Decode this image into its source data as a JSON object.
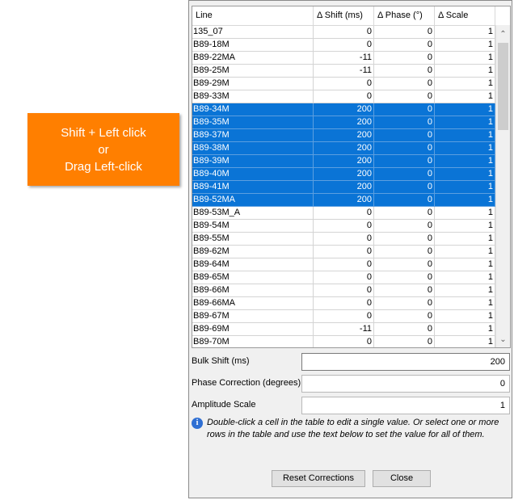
{
  "callout": {
    "line1": "Shift + Left click",
    "line2": "or",
    "line3": "Drag Left-click",
    "color": "#ff7f00"
  },
  "table": {
    "headers": [
      "Line",
      "Δ Shift (ms)",
      "Δ Phase (°)",
      "Δ Scale"
    ],
    "selection_color": "#0a74d6",
    "rows": [
      {
        "line": "135_07",
        "shift": "0",
        "phase": "0",
        "scale": "1",
        "selected": false
      },
      {
        "line": "B89-18M",
        "shift": "0",
        "phase": "0",
        "scale": "1",
        "selected": false
      },
      {
        "line": "B89-22MA",
        "shift": "-11",
        "phase": "0",
        "scale": "1",
        "selected": false
      },
      {
        "line": "B89-25M",
        "shift": "-11",
        "phase": "0",
        "scale": "1",
        "selected": false
      },
      {
        "line": "B89-29M",
        "shift": "0",
        "phase": "0",
        "scale": "1",
        "selected": false
      },
      {
        "line": "B89-33M",
        "shift": "0",
        "phase": "0",
        "scale": "1",
        "selected": false
      },
      {
        "line": "B89-34M",
        "shift": "200",
        "phase": "0",
        "scale": "1",
        "selected": true
      },
      {
        "line": "B89-35M",
        "shift": "200",
        "phase": "0",
        "scale": "1",
        "selected": true
      },
      {
        "line": "B89-37M",
        "shift": "200",
        "phase": "0",
        "scale": "1",
        "selected": true
      },
      {
        "line": "B89-38M",
        "shift": "200",
        "phase": "0",
        "scale": "1",
        "selected": true
      },
      {
        "line": "B89-39M",
        "shift": "200",
        "phase": "0",
        "scale": "1",
        "selected": true
      },
      {
        "line": "B89-40M",
        "shift": "200",
        "phase": "0",
        "scale": "1",
        "selected": true
      },
      {
        "line": "B89-41M",
        "shift": "200",
        "phase": "0",
        "scale": "1",
        "selected": true
      },
      {
        "line": "B89-52MA",
        "shift": "200",
        "phase": "0",
        "scale": "1",
        "selected": true
      },
      {
        "line": "B89-53M_A",
        "shift": "0",
        "phase": "0",
        "scale": "1",
        "selected": false
      },
      {
        "line": "B89-54M",
        "shift": "0",
        "phase": "0",
        "scale": "1",
        "selected": false
      },
      {
        "line": "B89-55M",
        "shift": "0",
        "phase": "0",
        "scale": "1",
        "selected": false
      },
      {
        "line": "B89-62M",
        "shift": "0",
        "phase": "0",
        "scale": "1",
        "selected": false
      },
      {
        "line": "B89-64M",
        "shift": "0",
        "phase": "0",
        "scale": "1",
        "selected": false
      },
      {
        "line": "B89-65M",
        "shift": "0",
        "phase": "0",
        "scale": "1",
        "selected": false
      },
      {
        "line": "B89-66M",
        "shift": "0",
        "phase": "0",
        "scale": "1",
        "selected": false
      },
      {
        "line": "B89-66MA",
        "shift": "0",
        "phase": "0",
        "scale": "1",
        "selected": false
      },
      {
        "line": "B89-67M",
        "shift": "0",
        "phase": "0",
        "scale": "1",
        "selected": false
      },
      {
        "line": "B89-69M",
        "shift": "-11",
        "phase": "0",
        "scale": "1",
        "selected": false
      },
      {
        "line": "B89-70M",
        "shift": "0",
        "phase": "0",
        "scale": "1",
        "selected": false
      }
    ]
  },
  "fields": {
    "bulk_shift": {
      "label": "Bulk Shift (ms)",
      "value": "200"
    },
    "phase_correction": {
      "label": "Phase Correction (degrees)",
      "value": "0"
    },
    "amplitude_scale": {
      "label": "Amplitude Scale",
      "value": "1"
    }
  },
  "hint": {
    "icon": "info-icon",
    "text": "Double-click a cell in the table to edit a single value. Or select one or more rows in the table and use the text below to set the value for all of them."
  },
  "buttons": {
    "reset_label": "Reset Corrections",
    "close_label": "Close"
  }
}
